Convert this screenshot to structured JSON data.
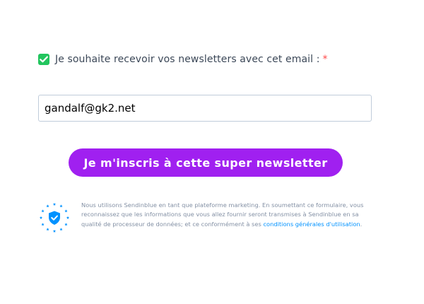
{
  "form": {
    "consent": {
      "label": "Je souhaite recevoir vos newsletters avec cet email :",
      "required_mark": "*",
      "checked": true
    },
    "email": {
      "value": "gandalf@gk2.net",
      "placeholder": ""
    },
    "submit_label": "Je m'inscris à cette super newsletter",
    "gdpr": {
      "text": "Nous utilisons Sendinblue en tant que plateforme marketing. En soumettant ce formulaire, vous reconnaissez que les informations que vous allez fournir seront transmises à Sendinblue en sa qualité de processeur de données; et ce conformément à ses ",
      "link_label": "conditions générales d'utilisation",
      "suffix": "."
    }
  },
  "icons": {
    "checkbox": "checkmark-icon",
    "gdpr": "eu-shield-icon"
  },
  "colors": {
    "checkbox": "#22c55e",
    "required": "#ff4949",
    "button": "#a020f0",
    "link": "#0092ff",
    "eu_stars": "#0092ff"
  }
}
